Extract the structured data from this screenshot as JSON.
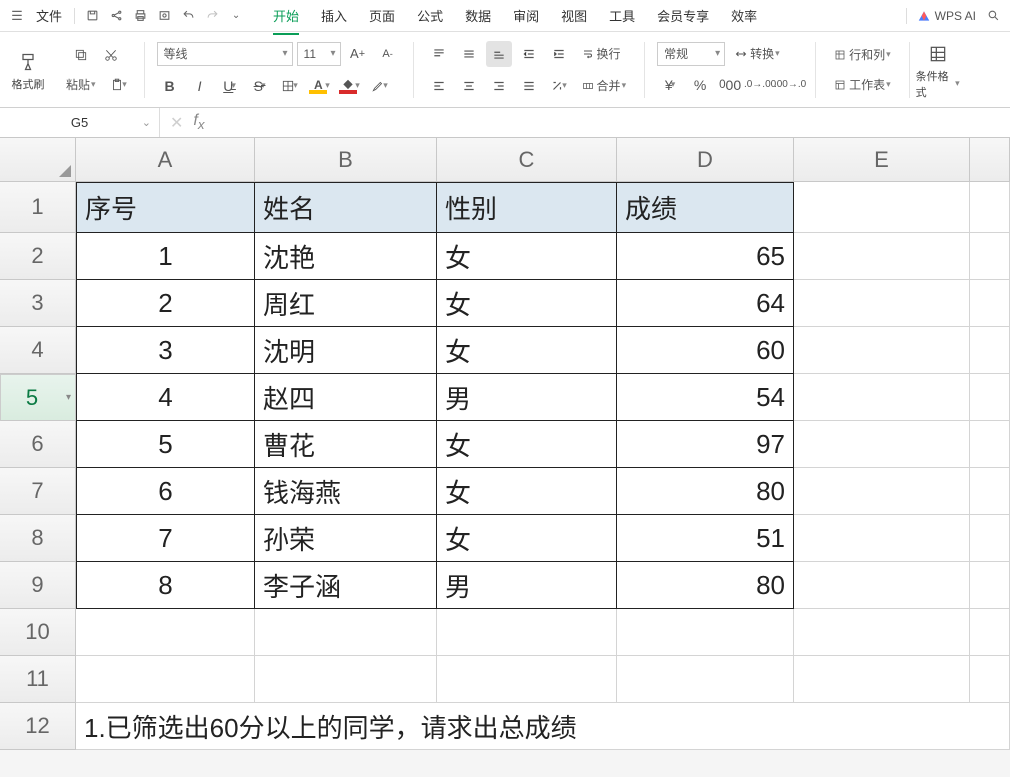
{
  "menubar": {
    "file_label": "文件",
    "tabs": [
      "开始",
      "插入",
      "页面",
      "公式",
      "数据",
      "审阅",
      "视图",
      "工具",
      "会员专享",
      "效率"
    ],
    "active_tab": 0,
    "ai_label": "WPS AI"
  },
  "ribbon": {
    "format_painter": "格式刷",
    "paste": "粘贴",
    "font_name": "等线",
    "font_size": "11",
    "wrap_text": "换行",
    "merge": "合并",
    "number_format": "常规",
    "convert": "转换",
    "rowcol": "行和列",
    "worksheet": "工作表",
    "conditional": "条件格式"
  },
  "formula_bar": {
    "name_box": "G5",
    "formula": ""
  },
  "columns": [
    "A",
    "B",
    "C",
    "D",
    "E"
  ],
  "rows": [
    "1",
    "2",
    "3",
    "4",
    "5",
    "6",
    "7",
    "8",
    "9",
    "10",
    "11",
    "12"
  ],
  "selected_row": "5",
  "headers": {
    "a": "序号",
    "b": "姓名",
    "c": "性别",
    "d": "成绩"
  },
  "data": [
    {
      "no": "1",
      "name": "沈艳",
      "sex": "女",
      "score": "65"
    },
    {
      "no": "2",
      "name": "周红",
      "sex": "女",
      "score": "64"
    },
    {
      "no": "3",
      "name": "沈明",
      "sex": "女",
      "score": "60"
    },
    {
      "no": "4",
      "name": "赵四",
      "sex": "男",
      "score": "54"
    },
    {
      "no": "5",
      "name": "曹花",
      "sex": "女",
      "score": "97"
    },
    {
      "no": "6",
      "name": "钱海燕",
      "sex": "女",
      "score": "80"
    },
    {
      "no": "7",
      "name": "孙荣",
      "sex": "女",
      "score": "51"
    },
    {
      "no": "8",
      "name": "李子涵",
      "sex": "男",
      "score": "80"
    }
  ],
  "note": "1.已筛选出60分以上的同学，请求出总成绩"
}
